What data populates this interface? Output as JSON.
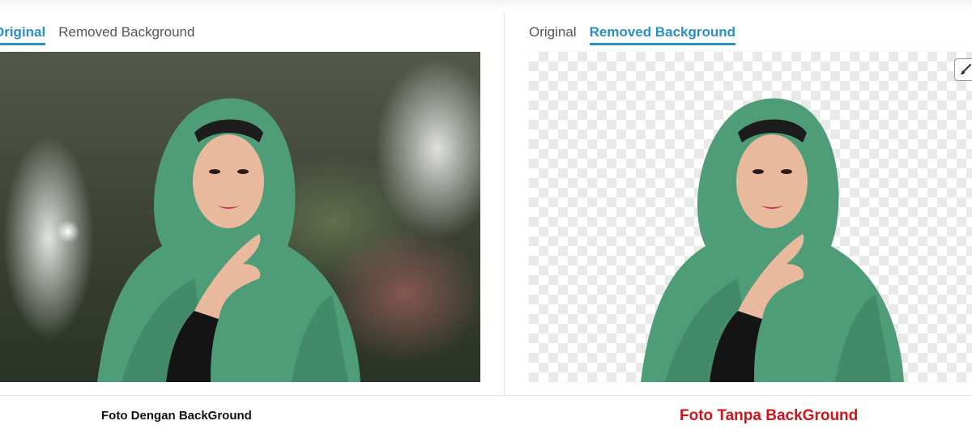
{
  "left_panel": {
    "tabs": [
      {
        "label": "Original",
        "active": true
      },
      {
        "label": "Removed Background",
        "active": false
      }
    ],
    "caption": "Foto Dengan BackGround"
  },
  "right_panel": {
    "tabs": [
      {
        "label": "Original",
        "active": false
      },
      {
        "label": "Removed Background",
        "active": true
      }
    ],
    "edit_icon": "paintbrush-icon",
    "caption": "Foto Tanpa BackGround"
  },
  "colors": {
    "accent": "#2b8fc4",
    "caption_red": "#d0141b",
    "checker": "#e9e9e9"
  }
}
